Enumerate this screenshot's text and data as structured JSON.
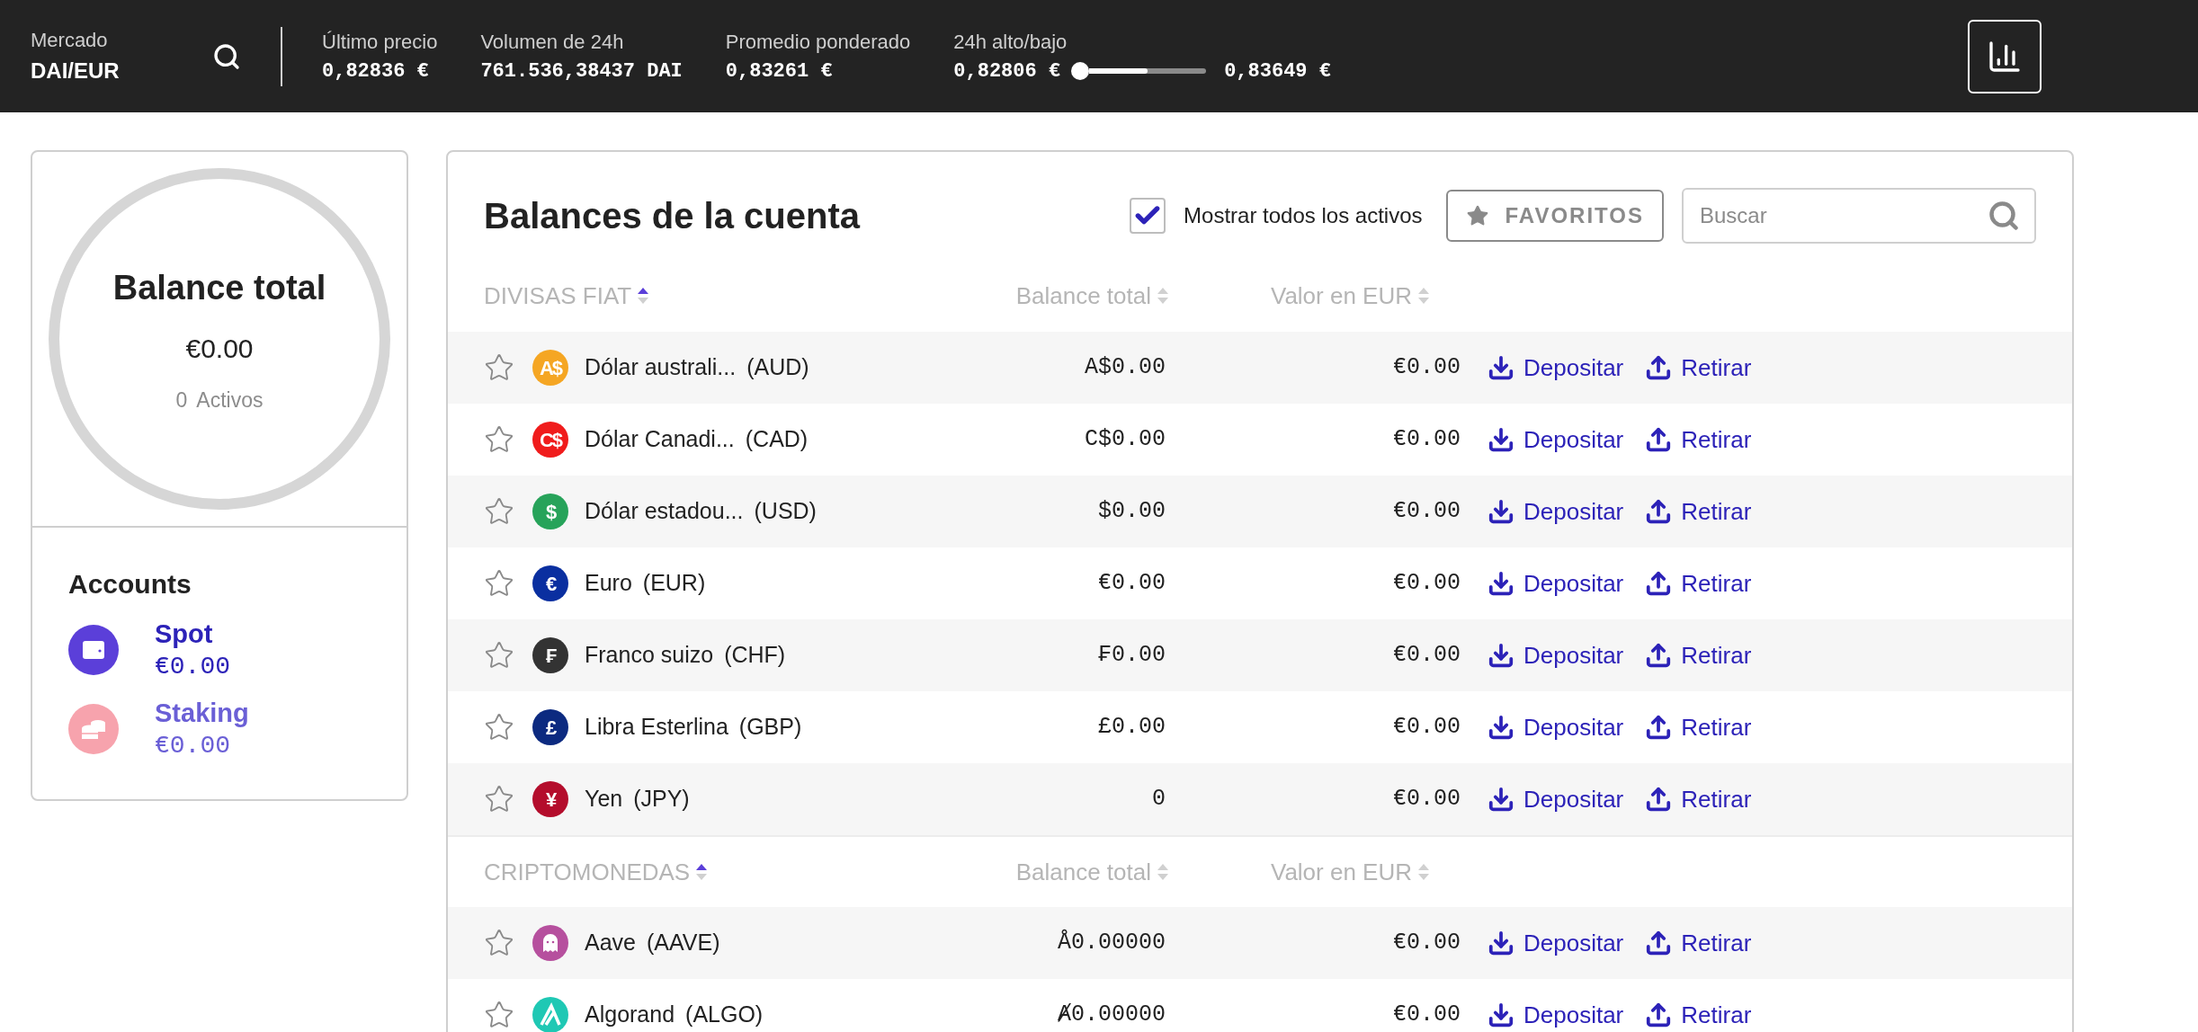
{
  "market": {
    "label": "Mercado",
    "pair": "DAI/EUR"
  },
  "stats": [
    {
      "label": "Último precio",
      "value": "0,82836 €"
    },
    {
      "label": "Volumen de 24h",
      "value": "761.536,38437 DAI"
    },
    {
      "label": "Promedio ponderado",
      "value": "0,83261 €"
    }
  ],
  "range": {
    "label": "24h alto/bajo",
    "low": "0,82806 €",
    "high": "0,83649 €",
    "level": 0.5
  },
  "summary": {
    "title": "Balance total",
    "amount": "€0.00",
    "count": "0",
    "count_label": "Activos"
  },
  "accounts": {
    "title": "Accounts",
    "items": [
      {
        "kind": "wallet",
        "name": "Spot",
        "amount": "€0.00",
        "color": "#2c22b8"
      },
      {
        "kind": "coins",
        "name": "Staking",
        "amount": "€0.00",
        "color": "#6a5fd6"
      }
    ]
  },
  "balances": {
    "title": "Balances de la cuenta",
    "show_all": {
      "label": "Mostrar todos los activos",
      "checked": true
    },
    "favorites_button": "FAVORITOS",
    "search": {
      "placeholder": "Buscar"
    },
    "sections": [
      {
        "columns": [
          {
            "label": "DIVISAS FIAT",
            "sorted": true
          },
          {
            "label": "Balance total",
            "sorted": false
          },
          {
            "label": "Valor en EUR",
            "sorted": false
          }
        ],
        "rows": [
          {
            "kind": "glyph",
            "symbol": "A$",
            "color": "#f5a623",
            "name": "Dólar australi...",
            "code": "(AUD)",
            "balance": "A$0.00",
            "value": "€0.00",
            "favorite": false,
            "deposit": "Depositar",
            "withdraw": "Retirar"
          },
          {
            "kind": "glyph",
            "symbol": "C$",
            "color": "#f01c1c",
            "name": "Dólar Canadi...",
            "code": "(CAD)",
            "balance": "C$0.00",
            "value": "€0.00",
            "favorite": false,
            "deposit": "Depositar",
            "withdraw": "Retirar"
          },
          {
            "kind": "glyph",
            "symbol": "$",
            "color": "#27a35a",
            "name": "Dólar estadou...",
            "code": "(USD)",
            "balance": "$0.00",
            "value": "€0.00",
            "favorite": false,
            "deposit": "Depositar",
            "withdraw": "Retirar"
          },
          {
            "kind": "glyph",
            "symbol": "€",
            "color": "#0a2fa0",
            "name": "Euro",
            "code": "(EUR)",
            "balance": "€0.00",
            "value": "€0.00",
            "favorite": false,
            "deposit": "Depositar",
            "withdraw": "Retirar"
          },
          {
            "kind": "glyph",
            "symbol": "₣",
            "color": "#333333",
            "name": "Franco suizo",
            "code": "(CHF)",
            "balance": "₣0.00",
            "value": "€0.00",
            "favorite": false,
            "deposit": "Depositar",
            "withdraw": "Retirar"
          },
          {
            "kind": "glyph",
            "symbol": "£",
            "color": "#0c2a80",
            "name": "Libra Esterlina",
            "code": "(GBP)",
            "balance": "£0.00",
            "value": "€0.00",
            "favorite": false,
            "deposit": "Depositar",
            "withdraw": "Retirar"
          },
          {
            "kind": "glyph",
            "symbol": "¥",
            "color": "#b40d2c",
            "name": "Yen",
            "code": "(JPY)",
            "balance": "0",
            "value": "€0.00",
            "favorite": false,
            "deposit": "Depositar",
            "withdraw": "Retirar"
          }
        ]
      },
      {
        "columns": [
          {
            "label": "CRIPTOMONEDAS",
            "sorted": true
          },
          {
            "label": "Balance total",
            "sorted": false
          },
          {
            "label": "Valor en EUR",
            "sorted": false
          }
        ],
        "rows": [
          {
            "kind": "ghost",
            "color": "#b6509e",
            "name": "Aave",
            "code": "(AAVE)",
            "balance": "Å0.00000",
            "value": "€0.00",
            "favorite": false,
            "deposit": "Depositar",
            "withdraw": "Retirar"
          },
          {
            "kind": "algo",
            "color": "#1fc8b4",
            "name": "Algorand",
            "code": "(ALGO)",
            "balance": "Ⱥ0.00000",
            "value": "€0.00",
            "favorite": false,
            "deposit": "Depositar",
            "withdraw": "Retirar"
          }
        ]
      }
    ]
  }
}
